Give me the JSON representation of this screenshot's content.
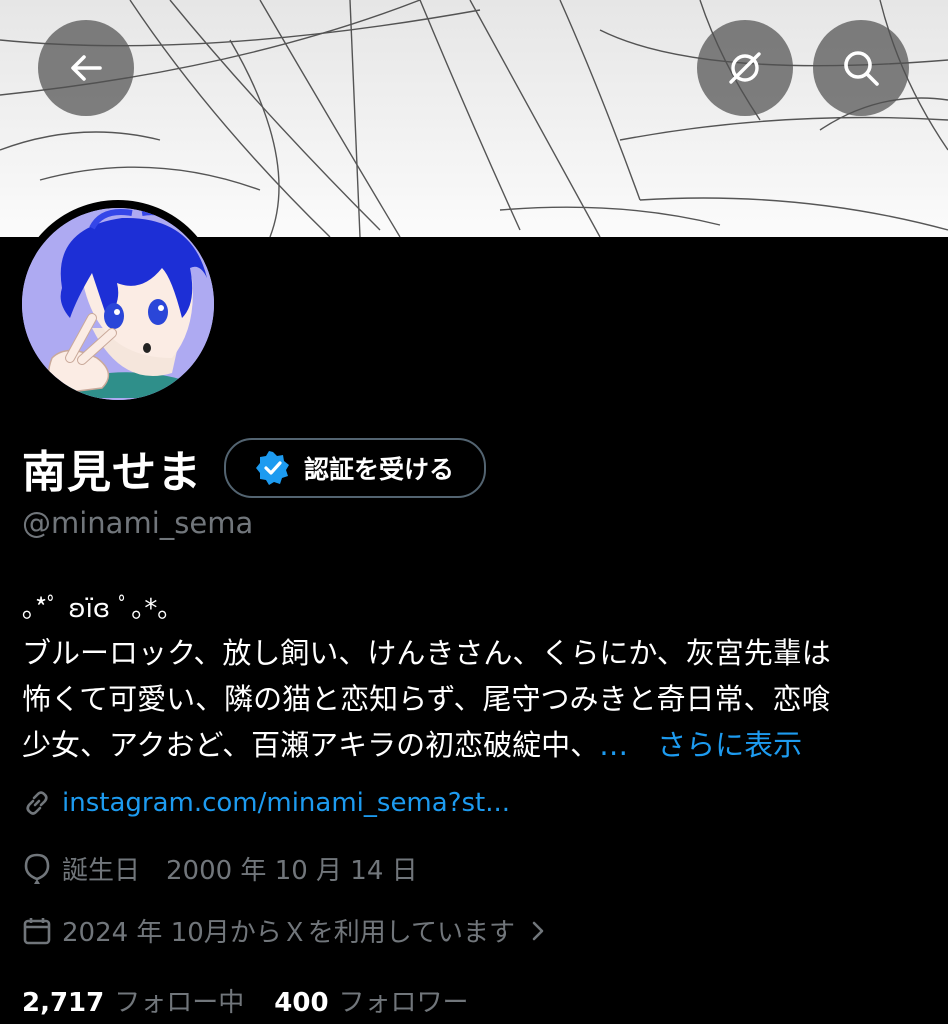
{
  "header": {
    "back_icon": "arrow-left-icon",
    "grok_icon": "grok-icon",
    "search_icon": "search-icon"
  },
  "profile": {
    "display_name": "南見せま",
    "verify_label": "認証を受ける",
    "handle": "@minami_sema",
    "bio_decoration": "｡*ﾟ ʚïɞ ﾟ｡*｡",
    "bio_lines": [
      "ブルーロック、放し飼い、けんきさん、くらにか、灰宮先輩は",
      "怖くて可愛い、隣の猫と恋知らず、尾守つみきと奇日常、恋喰",
      "少女、アクおど、百瀬アキラの初恋破綻中、"
    ],
    "bio_ellipsis": "…",
    "bio_more": "さらに表示",
    "link": "instagram.com/minami_sema?st...",
    "birthday": "誕生日　2000 年 10 月 14 日",
    "joined": "2024 年 10月からＸを利用しています",
    "following_count": "2,717",
    "following_label": "フォロー中",
    "followers_count": "400",
    "followers_label": "フォロワー"
  },
  "colors": {
    "accent": "#1d9bf0",
    "muted": "#71767b",
    "background": "#000000"
  }
}
